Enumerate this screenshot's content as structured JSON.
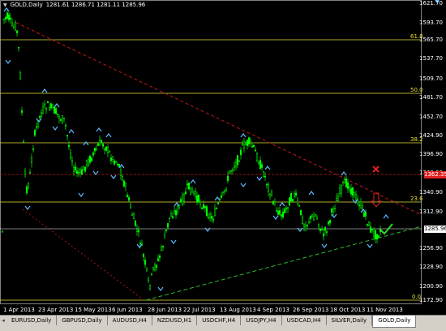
{
  "chart": {
    "symbol": "GOLD,Daily",
    "ohlc": "1281.61 1286.71 1281.11 1285.96",
    "current_price": "1285.96",
    "red_level": "1362.35",
    "price_axis": [
      "1621.70",
      "1593.70",
      "1565.70",
      "1537.70",
      "1509.70",
      "1481.70",
      "1452.70",
      "1424.90",
      "1396.90",
      "1368.90",
      "1340.90",
      "1312.90",
      "1256.90",
      "1228.90",
      "1200.90",
      "1172.90"
    ],
    "fib_levels": [
      "61.8",
      "50.0",
      "38.2",
      "23.6",
      "0.0"
    ],
    "dates": [
      "1 Apr 2013",
      "23 Apr 2013",
      "15 May 2013",
      "6 Jun 2013",
      "28 Jun 2013",
      "22 Jul 2013",
      "13 Aug 2013",
      "4 Sep 2013",
      "26 Sep 2013",
      "18 Oct 2013",
      "11 Nov 2013"
    ],
    "colors": {
      "candles": "#00ff00",
      "fib": "#e8e23a",
      "resistance": "#c41818",
      "support": "#2eb82e",
      "fractal": "#5cb8ff",
      "sell_mark": "#e02020"
    }
  },
  "tabs": [
    "EURUSD,Daily",
    "GBPUSD,Daily",
    "AUDUSD,H4",
    "NZDUSD,H1",
    "USDCHF,H4",
    "USDJPY,H4",
    "USDCAD,H4",
    "SILVER,Daily",
    "GOLD,Daily"
  ],
  "active_tab": "GOLD,Daily"
}
